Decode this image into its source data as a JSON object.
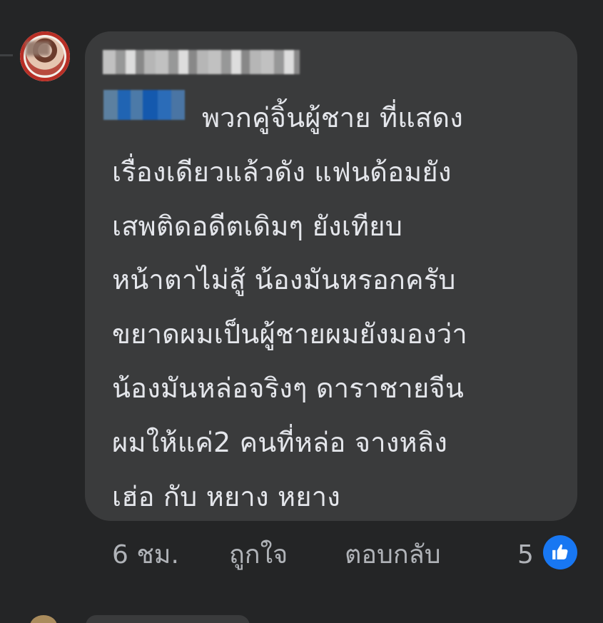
{
  "comment": {
    "lines": [
      "พวกคู่จิ้นผู้ชาย ที่แสดง",
      "เรื่องเดียวแล้วดัง  แฟนด้อมยัง",
      "เสพติดอดีตเดิมๆ ยังเทียบ",
      "หน้าตาไม่สู้ น้องมันหรอกครับ",
      "ขยาดผมเป็นผู้ชายผมยังมองว่า",
      "น้องมันหล่อจริงๆ ดาราชายจีน",
      "ผมให้แค่2 คนที่หล่อ  จางหลิง",
      "เฮ่อ กับ หยาง หยาง"
    ]
  },
  "actions": {
    "time": "6 ชม.",
    "like": "ถูกใจ",
    "reply": "ตอบกลับ",
    "reaction_count": "5"
  },
  "icons": {
    "reaction": "like-thumb-icon"
  },
  "colors": {
    "background": "#242526",
    "bubble": "#3a3b3c",
    "text": "#e4e6eb",
    "secondary_text": "#b0b3b8",
    "reaction_blue": "#1877f2"
  }
}
